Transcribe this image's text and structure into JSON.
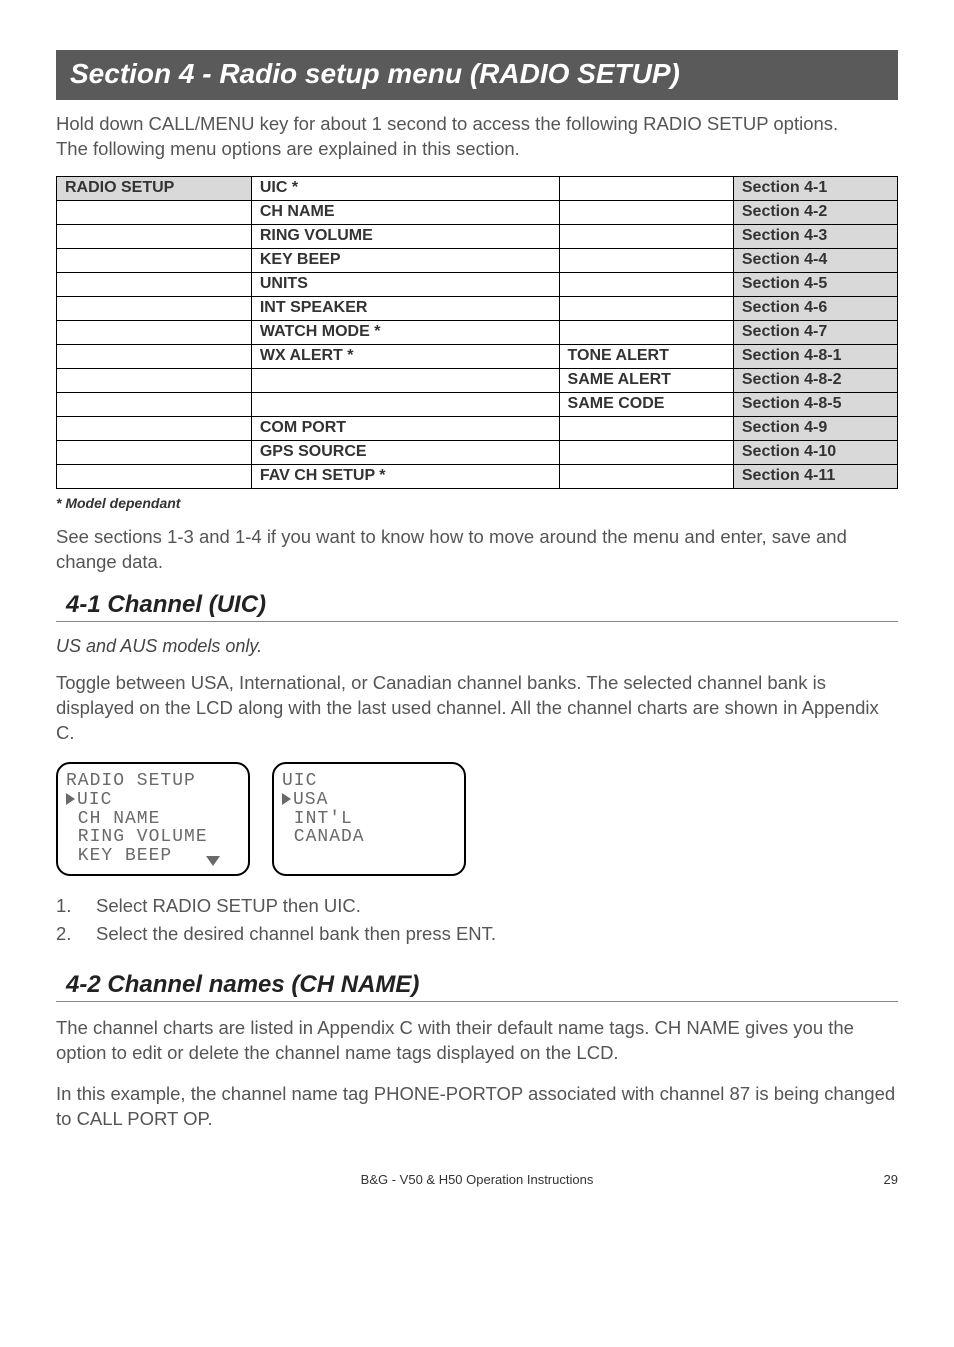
{
  "banner": "Section 4 -  Radio setup menu (RADIO SETUP)",
  "intro_line1": "Hold down CALL/MENU key for about 1 second to access the following RADIO SETUP options.",
  "intro_line2": "The following menu options are explained in this section.",
  "table": {
    "rows": [
      {
        "c1": "RADIO SETUP",
        "c2": "UIC  *",
        "c3": "",
        "c4": "Section 4-1",
        "c1hdr": true,
        "c4hdr": true
      },
      {
        "c1": "",
        "c2": "CH NAME",
        "c3": "",
        "c4": "Section 4-2",
        "c4hdr": true
      },
      {
        "c1": "",
        "c2": "RING VOLUME",
        "c3": "",
        "c4": "Section 4-3",
        "c4hdr": true
      },
      {
        "c1": "",
        "c2": "KEY BEEP",
        "c3": "",
        "c4": "Section 4-4",
        "c4hdr": true
      },
      {
        "c1": "",
        "c2": "UNITS",
        "c3": "",
        "c4": "Section 4-5",
        "c4hdr": true
      },
      {
        "c1": "",
        "c2": "INT SPEAKER",
        "c3": "",
        "c4": "Section 4-6",
        "c4hdr": true
      },
      {
        "c1": "",
        "c2": "WATCH MODE  *",
        "c3": "",
        "c4": "Section 4-7",
        "c4hdr": true
      },
      {
        "c1": "",
        "c2": "WX ALERT  *",
        "c3": "TONE ALERT",
        "c4": "Section 4-8-1",
        "c4hdr": true
      },
      {
        "c1": "",
        "c2": "",
        "c3": "SAME ALERT",
        "c4": "Section 4-8-2",
        "c4hdr": true
      },
      {
        "c1": "",
        "c2": "",
        "c3": "SAME CODE",
        "c4": "Section 4-8-5",
        "c4hdr": true
      },
      {
        "c1": "",
        "c2": "COM PORT",
        "c3": "",
        "c4": "Section 4-9",
        "c4hdr": true
      },
      {
        "c1": "",
        "c2": "GPS SOURCE",
        "c3": "",
        "c4": "Section 4-10",
        "c4hdr": true
      },
      {
        "c1": "",
        "c2": "FAV CH SETUP  *",
        "c3": "",
        "c4": "Section 4-11",
        "c4hdr": true
      }
    ]
  },
  "footnote": "* Model dependant",
  "see_sections": "See sections 1-3 and 1-4 if you want to know how to move around the menu and enter, save and change data.",
  "sec41": {
    "heading": "4-1 Channel (UIC)",
    "subnote": "US and AUS models only.",
    "para": "Toggle between USA, International, or Canadian channel banks. The selected channel bank is displayed on the LCD along with the last used channel. All the channel charts are shown in Appendix C.",
    "lcd1": {
      "l1": "RADIO SETUP",
      "l2": "UIC",
      "l3": " CH NAME",
      "l4": " RING VOLUME",
      "l5": " KEY BEEP"
    },
    "lcd2": {
      "l1": "UIC",
      "l2": "USA",
      "l3": " INT'L",
      "l4": " CANADA"
    },
    "steps": [
      {
        "n": "1.",
        "t": "Select RADIO SETUP then UIC."
      },
      {
        "n": "2.",
        "t": "Select the desired channel bank then press ENT."
      }
    ]
  },
  "sec42": {
    "heading": "4-2 Channel names (CH NAME)",
    "p1": "The channel charts are listed in Appendix C with their default name tags. CH NAME gives you the option to edit or delete the channel name tags displayed on the LCD.",
    "p2": "In this example, the channel name tag PHONE-PORTOP associated with channel 87 is being changed to CALL PORT OP."
  },
  "footer": {
    "center": "B&G - V50 & H50 Operation Instructions",
    "page": "29"
  }
}
